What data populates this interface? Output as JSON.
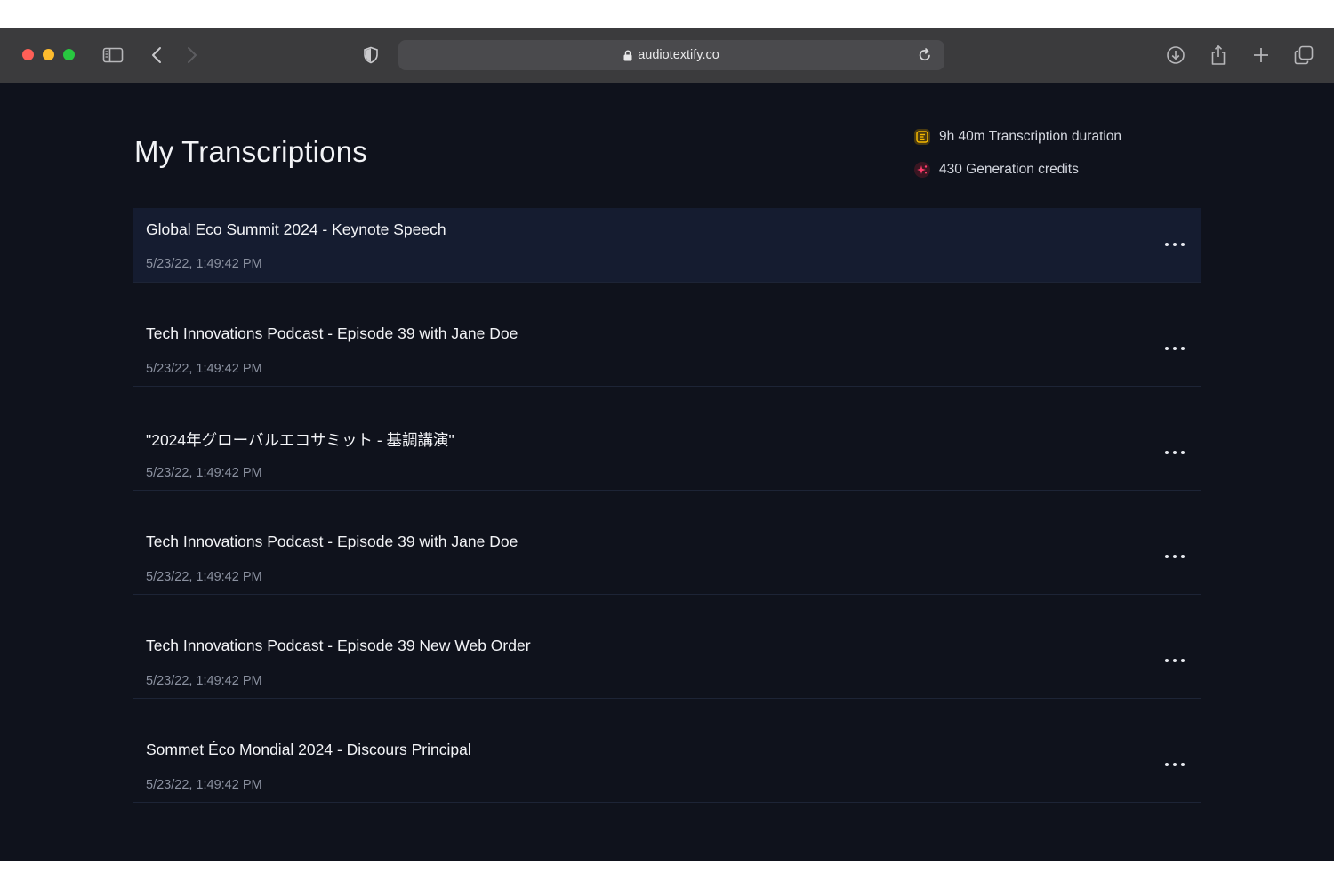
{
  "browser": {
    "url": "audiotextify.co",
    "icons": {
      "sidebar": "sidebar-icon",
      "back": "chevron-left-icon",
      "forward": "chevron-right-icon",
      "shield": "shield-icon",
      "lock": "lock-icon",
      "reload": "reload-icon",
      "download": "download-icon",
      "share": "share-icon",
      "new_tab": "plus-icon",
      "tabs": "tabs-overview-icon"
    }
  },
  "header": {
    "title": "My Transcriptions"
  },
  "stats": {
    "duration": {
      "label": "9h 40m Transcription duration",
      "icon": "transcription-duration-icon",
      "color": "#f5b800"
    },
    "credits": {
      "label": "430 Generation credits",
      "icon": "sparkle-icon",
      "color": "#ff3b6b"
    }
  },
  "transcriptions": [
    {
      "title": "Global Eco Summit 2024 - Keynote Speech",
      "date": "5/23/22, 1:49:42 PM"
    },
    {
      "title": "Tech Innovations Podcast - Episode 39 with Jane Doe",
      "date": "5/23/22, 1:49:42 PM"
    },
    {
      "title": "\"2024年グローバルエコサミット - 基調講演\"",
      "date": "5/23/22, 1:49:42 PM"
    },
    {
      "title": "Tech Innovations Podcast - Episode 39 with Jane Doe",
      "date": "5/23/22, 1:49:42 PM"
    },
    {
      "title": "Tech Innovations Podcast - Episode 39 New Web Order",
      "date": "5/23/22, 1:49:42 PM"
    },
    {
      "title": "Sommet Éco Mondial 2024 - Discours Principal",
      "date": "5/23/22, 1:49:42 PM"
    }
  ],
  "colors": {
    "background": "#0f121c",
    "toolbar": "#3b3b3d",
    "active_row": "#151c30",
    "divider": "#1d2436"
  }
}
